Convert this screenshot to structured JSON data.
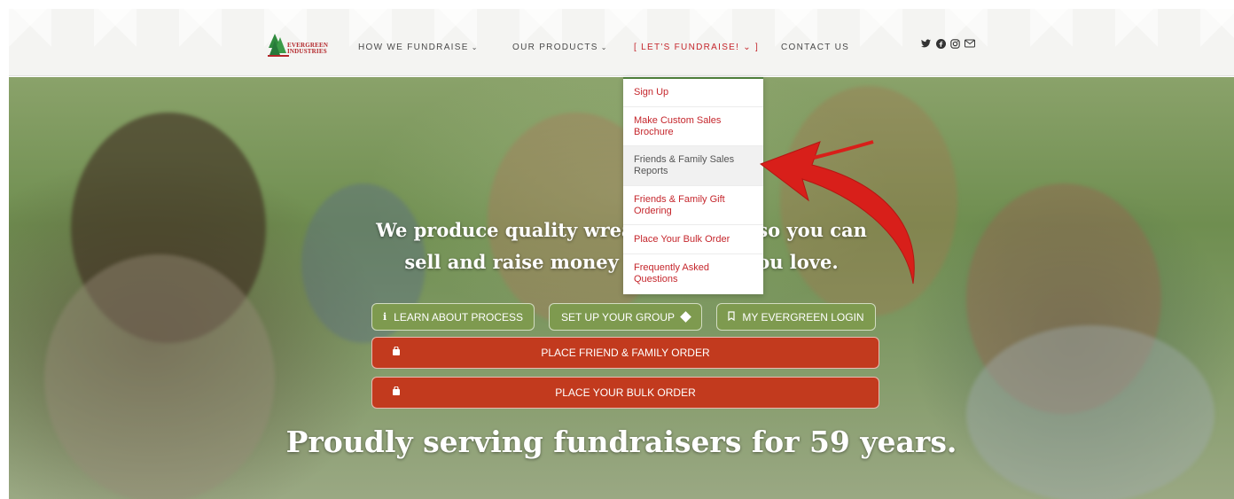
{
  "nav": {
    "logo_text": "EVERGREEN INDUSTRIES",
    "items": [
      {
        "label": "HOW WE FUNDRAISE",
        "chevron": "⌄"
      },
      {
        "label": "OUR PRODUCTS",
        "chevron": "⌄"
      },
      {
        "label": "[ LET'S FUNDRAISE! ⌄ ]"
      },
      {
        "label": "CONTACT US"
      }
    ],
    "social": [
      "twitter-icon",
      "facebook-icon",
      "instagram-icon",
      "email-icon"
    ]
  },
  "dropdown": {
    "items": [
      {
        "label": "Sign Up"
      },
      {
        "label": "Make Custom Sales Brochure"
      },
      {
        "label": "Friends & Family Sales Reports"
      },
      {
        "label": "Friends & Family Gift Ordering"
      },
      {
        "label": "Place Your Bulk Order"
      },
      {
        "label": "Frequently Asked Questions"
      }
    ]
  },
  "hero": {
    "line1": "We produce quality wreat",
    "line1_right": "so you can",
    "line2": "sell and raise money f",
    "line2_right": "ou love.",
    "tagline": "Proudly serving fundraisers for 59 years."
  },
  "buttons": {
    "learn": "LEARN ABOUT PROCESS",
    "setup": "SET UP YOUR GROUP",
    "login": "MY EVERGREEN LOGIN",
    "friend_order": "PLACE FRIEND & FAMILY ORDER",
    "bulk_order": "PLACE YOUR BULK ORDER"
  },
  "colors": {
    "accent_red": "#c5262c",
    "button_green": "#7e9a4f",
    "button_red": "#c23a1e",
    "arrow_red": "#d81f1a"
  }
}
